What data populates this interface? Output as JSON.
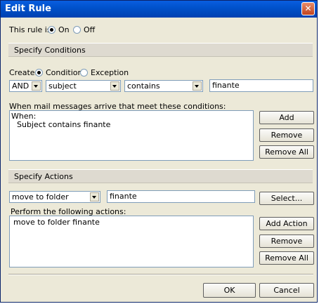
{
  "window": {
    "title": "Edit Rule",
    "close_glyph": "✕"
  },
  "status_row": {
    "label": "This rule is:",
    "on": "On",
    "off": "Off",
    "selected": "On"
  },
  "conditions": {
    "header": "Specify Conditions",
    "create_label": "Create:",
    "condition_option": "Condition",
    "exception_option": "Exception",
    "selected_option": "Condition",
    "logic_value": "AND",
    "field_value": "subject",
    "operator_value": "contains",
    "text_value": "finante",
    "list_label": "When mail messages arrive that meet these conditions:",
    "list_lines": [
      "When:",
      "Subject  contains finante"
    ],
    "add": "Add",
    "remove": "Remove",
    "remove_all": "Remove All"
  },
  "actions": {
    "header": "Specify Actions",
    "action_value": "move to folder",
    "folder_value": "finante",
    "select_button": "Select...",
    "list_label": "Perform the following actions:",
    "list_lines": [
      "move to folder finante"
    ],
    "add": "Add Action",
    "remove": "Remove",
    "remove_all": "Remove All"
  },
  "footer": {
    "ok": "OK",
    "cancel": "Cancel"
  },
  "colors": {
    "title_bar": "#0052cc",
    "dialog_bg": "#ece9d8",
    "section_bg": "#dedad0",
    "close_button": "#c2441d"
  }
}
